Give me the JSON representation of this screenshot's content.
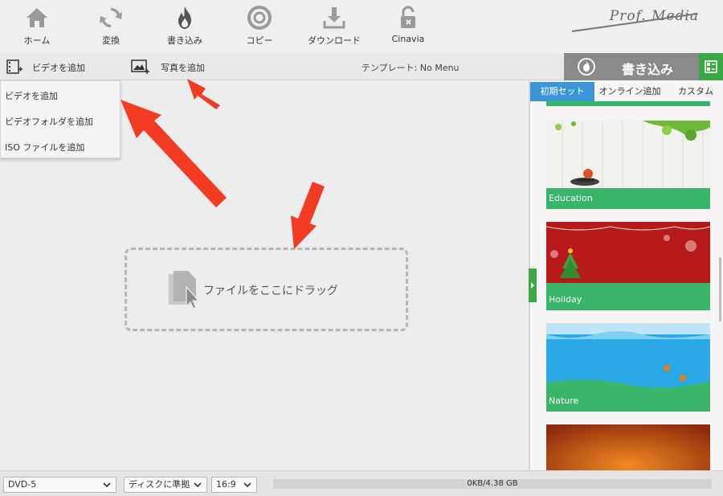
{
  "toolbar": {
    "items": [
      {
        "label": "ホーム",
        "icon": "home-icon"
      },
      {
        "label": "変換",
        "icon": "convert-icon"
      },
      {
        "label": "書き込み",
        "icon": "burn-flame-icon"
      },
      {
        "label": "コピー",
        "icon": "copy-disc-icon"
      },
      {
        "label": "ダウンロード",
        "icon": "download-icon"
      },
      {
        "label": "Cinavia",
        "icon": "unlock-icon"
      }
    ],
    "brand": "Prof. Media"
  },
  "actionbar": {
    "add_video": "ビデオを追加",
    "add_photo": "写真を追加",
    "template": "テンプレート: No Menu",
    "burn": "書き込み"
  },
  "dropdown": {
    "items": [
      "ビデオを追加",
      "ビデオフォルダを追加",
      "ISO ファイルを追加"
    ]
  },
  "dropzone": {
    "text": "ファイルをここにドラッグ"
  },
  "sidepanel": {
    "tabs": [
      "初期セット",
      "オンライン追加",
      "カスタム"
    ],
    "active_tab": "初期セット",
    "templates": [
      {
        "name": "Education"
      },
      {
        "name": "Holiday"
      },
      {
        "name": "Nature"
      }
    ]
  },
  "bottombar": {
    "disc_type": "DVD-5",
    "status": "ディスクに準拠",
    "aspect": "16:9",
    "capacity": "0KB/4.38 GB"
  },
  "colors": {
    "accent_green": "#3aa845",
    "tab_blue": "#3b96d8",
    "arrow_red": "#f33a22"
  }
}
